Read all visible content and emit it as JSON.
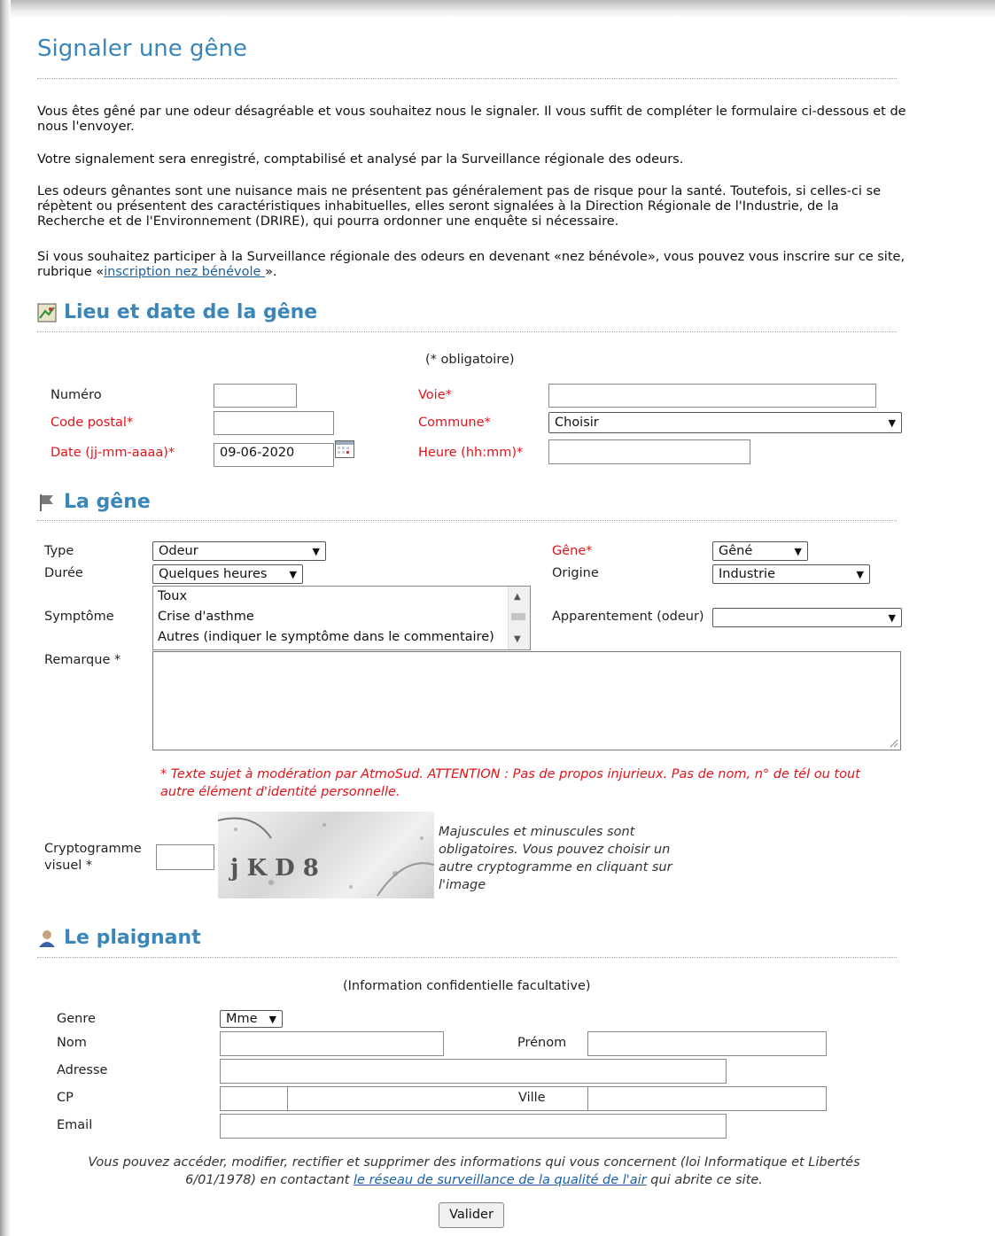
{
  "page_title": "Signaler une gêne",
  "intro": {
    "p1": "Vous êtes gêné par une odeur désagréable et vous souhaitez nous le signaler. Il vous suffit de compléter le formulaire ci-dessous et de nous l'envoyer.",
    "p2": "Votre signalement sera enregistré, comptabilisé et analysé par la Surveillance régionale des odeurs.",
    "p3": "Les odeurs gênantes sont une nuisance mais ne présentent pas généralement pas de risque pour la santé. Toutefois, si celles-ci se répètent ou présentent des caractéristiques inhabituelles, elles seront signalées à la Direction Régionale de l'Industrie, de la Recherche et de l'Environnement (DRIRE), qui pourra ordonner une enquête si nécessaire.",
    "p4_before": "Si vous souhaitez participer à la Surveillance régionale des odeurs en devenant «nez bénévole», vous pouvez vous inscrire sur ce site, rubrique «",
    "p4_link": "inscription nez bénévole ",
    "p4_after": "»."
  },
  "section_lieu": {
    "title": "Lieu et date de la gêne",
    "required_note": "(* obligatoire)",
    "numero_label": "Numéro",
    "voie_label": "Voie*",
    "code_postal_label": "Code postal*",
    "commune_label": "Commune*",
    "commune_value": "Choisir",
    "date_label": "Date (jj-mm-aaaa)*",
    "date_value": "09-06-2020",
    "heure_label": "Heure (hh:mm)*"
  },
  "section_gene": {
    "title": "La gêne",
    "type_label": "Type",
    "type_value": "Odeur",
    "gene_label": "Gêne*",
    "gene_value": "Gêné",
    "duree_label": "Durée",
    "duree_value": "Quelques heures",
    "origine_label": "Origine",
    "origine_value": "Industrie",
    "symptome_label": "Symptôme",
    "symptome_options": [
      "Toux",
      "Crise d'asthme",
      "Autres (indiquer le symptôme dans le commentaire)"
    ],
    "apparentement_label": "Apparentement (odeur)",
    "apparentement_value": "",
    "remarque_label": "Remarque *",
    "warning": "* Texte sujet à modération par AtmoSud. ATTENTION : Pas de propos injurieux. Pas de nom, n° de tél ou tout autre élément d'identité personnelle.",
    "crypto_label_1": "Cryptogramme",
    "crypto_label_2": "visuel *",
    "captcha_text": "j K D 8",
    "crypto_help": "Majuscules et minuscules sont obligatoires. Vous pouvez choisir un autre cryptogramme en cliquant sur l'image"
  },
  "section_plaignant": {
    "title": "Le plaignant",
    "note": "(Information confidentielle facultative)",
    "genre_label": "Genre",
    "genre_value": "Mme",
    "nom_label": "Nom",
    "prenom_label": "Prénom",
    "adresse_label": "Adresse",
    "cp_label": "CP",
    "ville_label": "Ville",
    "email_label": "Email",
    "privacy_before": "Vous pouvez accéder, modifier, rectifier et supprimer des informations qui vous concernent (loi Informatique et Libertés 6/01/1978) en contactant ",
    "privacy_link": "le réseau de surveillance de la qualité de l'air",
    "privacy_after": " qui abrite ce site.",
    "submit_label": "Valider"
  },
  "colors": {
    "heading": "#3a86b9",
    "required": "#e1131a",
    "link": "#1a5fa0"
  },
  "icons": [
    "map-icon",
    "flag-icon",
    "person-icon",
    "calendar-icon",
    "chevron-down-icon"
  ]
}
